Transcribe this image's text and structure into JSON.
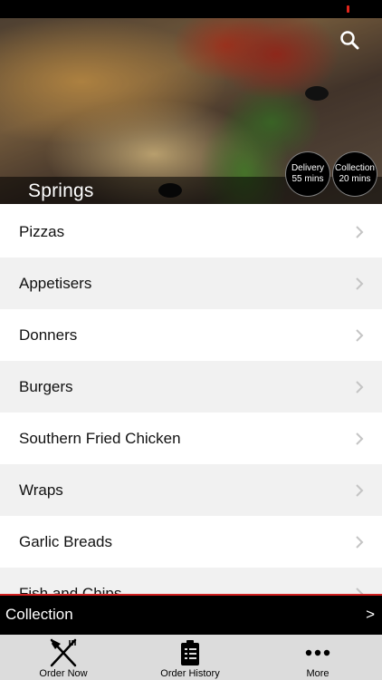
{
  "hero": {
    "store_name": "Springs",
    "delivery": {
      "label": "Delivery",
      "time": "55 mins"
    },
    "collection": {
      "label": "Collection",
      "time": "20 mins"
    }
  },
  "menu": {
    "items": [
      {
        "label": "Pizzas"
      },
      {
        "label": "Appetisers"
      },
      {
        "label": "Donners"
      },
      {
        "label": "Burgers"
      },
      {
        "label": "Southern Fried Chicken"
      },
      {
        "label": "Wraps"
      },
      {
        "label": "Garlic Breads"
      },
      {
        "label": "Fish and Chips"
      }
    ]
  },
  "order_bar": {
    "mode": "Collection",
    "arrow": ">"
  },
  "tabs": [
    {
      "label": "Order Now",
      "icon": "fork-knife-icon"
    },
    {
      "label": "Order History",
      "icon": "clipboard-list-icon"
    },
    {
      "label": "More",
      "icon": "more-dots-icon"
    }
  ],
  "colors": {
    "accent": "#d02020",
    "bar_bg": "#000000",
    "tab_bar_bg": "#dcdcdc"
  }
}
